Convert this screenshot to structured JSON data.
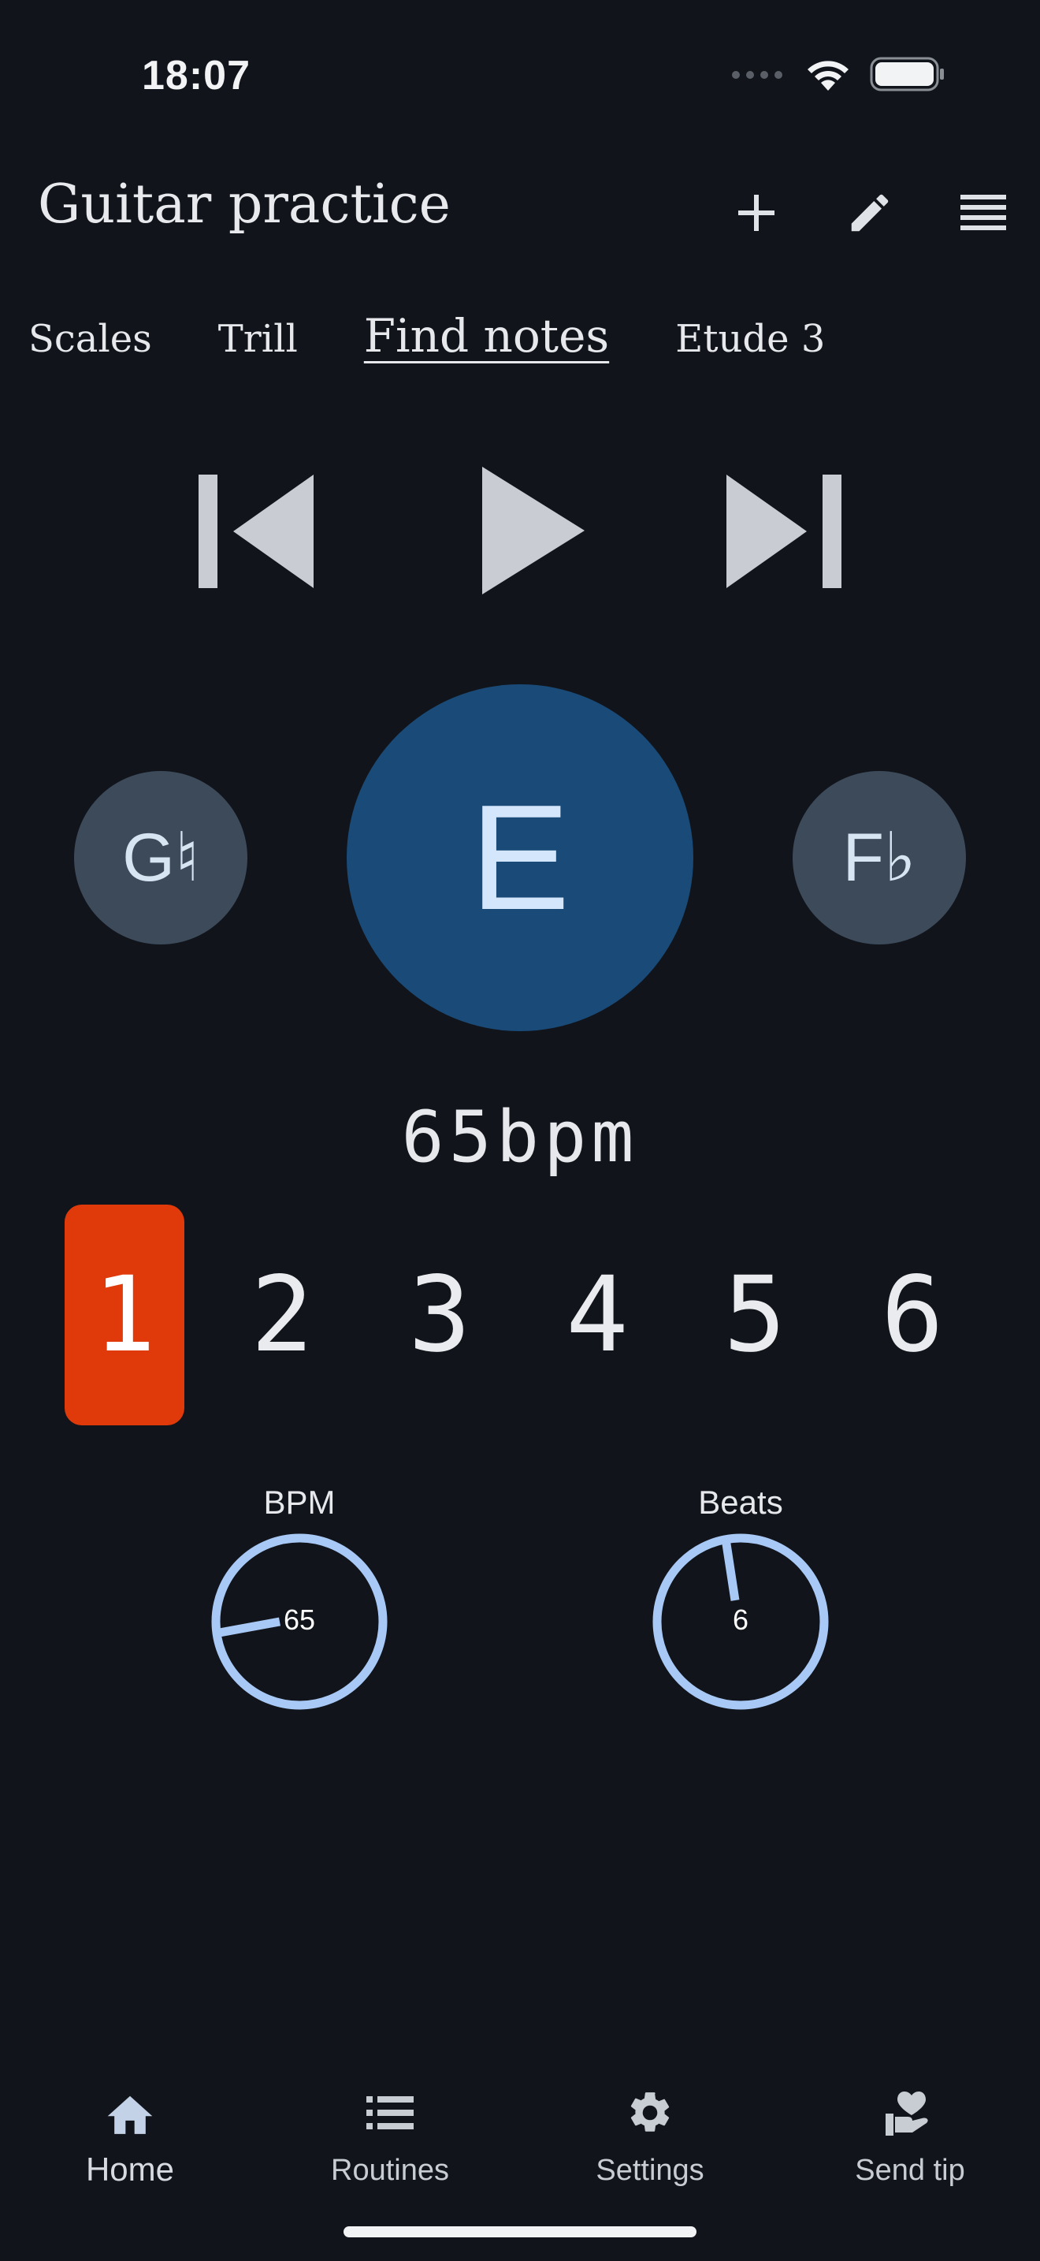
{
  "status_bar": {
    "time": "18:07"
  },
  "header": {
    "title": "Guitar practice",
    "icons": [
      "plus-icon",
      "pencil-icon",
      "menu-icon"
    ]
  },
  "tabs": [
    {
      "label": "Scales",
      "active": false
    },
    {
      "label": "Trill",
      "active": false
    },
    {
      "label": "Find notes",
      "active": true
    },
    {
      "label": "Etude 3",
      "active": false
    }
  ],
  "transport": {
    "icons": [
      "skip-previous-icon",
      "play-icon",
      "skip-next-icon"
    ]
  },
  "notes": {
    "previous": "G♮",
    "current": "E",
    "next": "F♭"
  },
  "tempo_display": "65bpm",
  "beats": {
    "labels": [
      "1",
      "2",
      "3",
      "4",
      "5",
      "6"
    ],
    "active_index": 0
  },
  "knobs": {
    "bpm": {
      "label": "BPM",
      "value": "65"
    },
    "beats": {
      "label": "Beats",
      "value": "6"
    }
  },
  "bottom_nav": {
    "items": [
      {
        "label": "Home",
        "icon": "home-icon",
        "active": true
      },
      {
        "label": "Routines",
        "icon": "list-icon",
        "active": false
      },
      {
        "label": "Settings",
        "icon": "gear-icon",
        "active": false
      },
      {
        "label": "Send tip",
        "icon": "heart-hand-icon",
        "active": false
      }
    ]
  },
  "colors": {
    "background": "#11151b",
    "accent_beat": "#e03a0b",
    "current_note": "#1a4a77",
    "side_note": "#3d4a5a",
    "knob": "#a8c8f5"
  }
}
